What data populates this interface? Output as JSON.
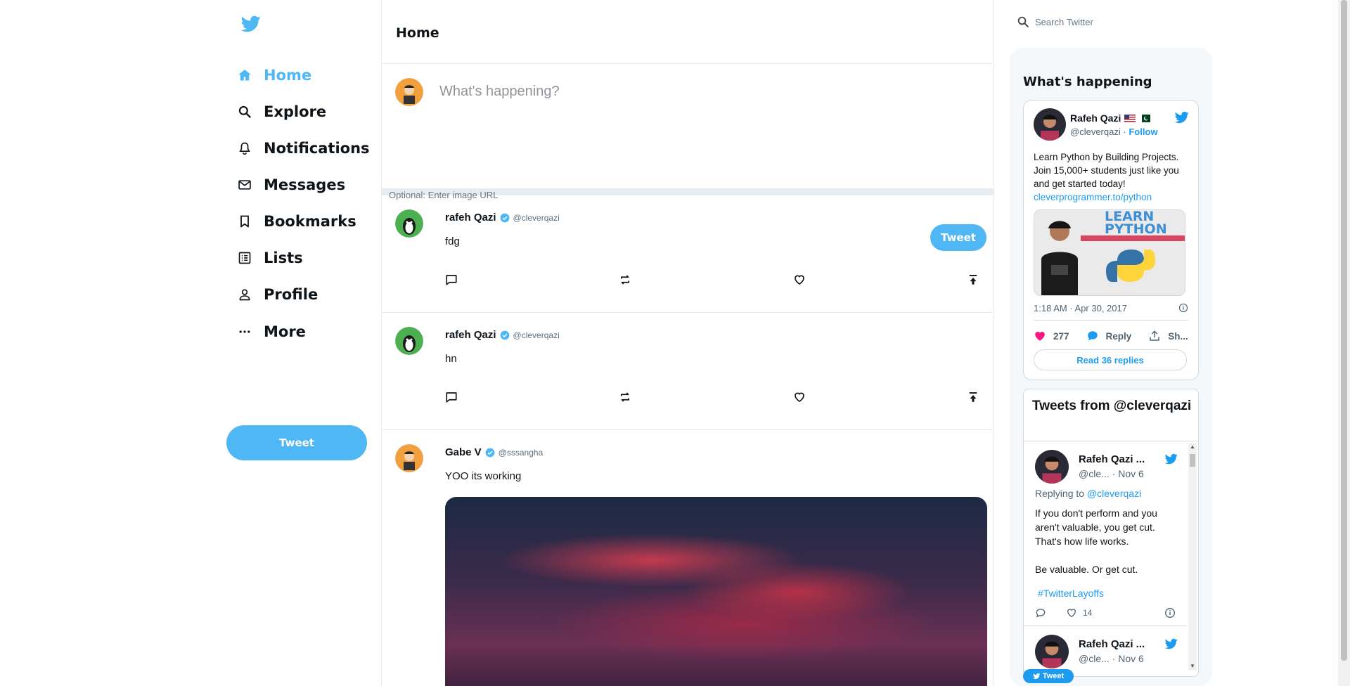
{
  "sidebar": {
    "items": [
      {
        "label": "Home",
        "icon": "home-icon",
        "active": true
      },
      {
        "label": "Explore",
        "icon": "search-icon"
      },
      {
        "label": "Notifications",
        "icon": "bell-icon"
      },
      {
        "label": "Messages",
        "icon": "mail-icon"
      },
      {
        "label": "Bookmarks",
        "icon": "bookmark-icon"
      },
      {
        "label": "Lists",
        "icon": "list-icon"
      },
      {
        "label": "Profile",
        "icon": "person-icon"
      },
      {
        "label": "More",
        "icon": "more-icon"
      }
    ],
    "tweet_button": "Tweet",
    "accent": "#50b7f5"
  },
  "feed": {
    "title": "Home",
    "tweetbox": {
      "placeholder": "What's happening?",
      "image_placeholder": "Optional: Enter image URL",
      "button": "Tweet"
    },
    "posts": [
      {
        "name": "rafeh Qazi",
        "handle": "@cleverqazi",
        "text": "fdg"
      },
      {
        "name": "rafeh Qazi",
        "handle": "@cleverqazi",
        "text": "hn"
      },
      {
        "name": "Gabe V",
        "handle": "@sssangha",
        "text": "YOO its working"
      }
    ]
  },
  "search": {
    "placeholder": "Search Twitter"
  },
  "widgets": {
    "title": "What's happening",
    "embed": {
      "name": "Rafeh Qazi",
      "handle": "@cleverqazi",
      "dot": "·",
      "follow": "Follow",
      "text": "Learn Python by Building Projects. Join 15,000+ students just like you and get started today!",
      "link": "cleverprogrammer.to/python",
      "image_text_1": "LEARN",
      "image_text_2": "PYTHON",
      "time": "1:18 AM · Apr 30, 2017",
      "likes": "277",
      "reply": "Reply",
      "share": "Sh...",
      "read_replies": "Read 36 replies"
    },
    "timeline": {
      "title": "Tweets from @cleverqazi",
      "items": [
        {
          "name": "Rafeh Qazi ...",
          "handle": "@cle... · Nov 6",
          "replying_label": "Replying to",
          "replying_to": "@cleverqazi",
          "body_1": "If you don't perform and you aren't valuable, you get cut. That's how life works.",
          "body_2": "Be valuable. Or get cut.",
          "hashtag": "#TwitterLayoffs",
          "likes": "14"
        },
        {
          "name": "Rafeh Qazi ...",
          "handle": "@cle... · Nov 6"
        }
      ]
    },
    "float_button": "Tweet"
  }
}
